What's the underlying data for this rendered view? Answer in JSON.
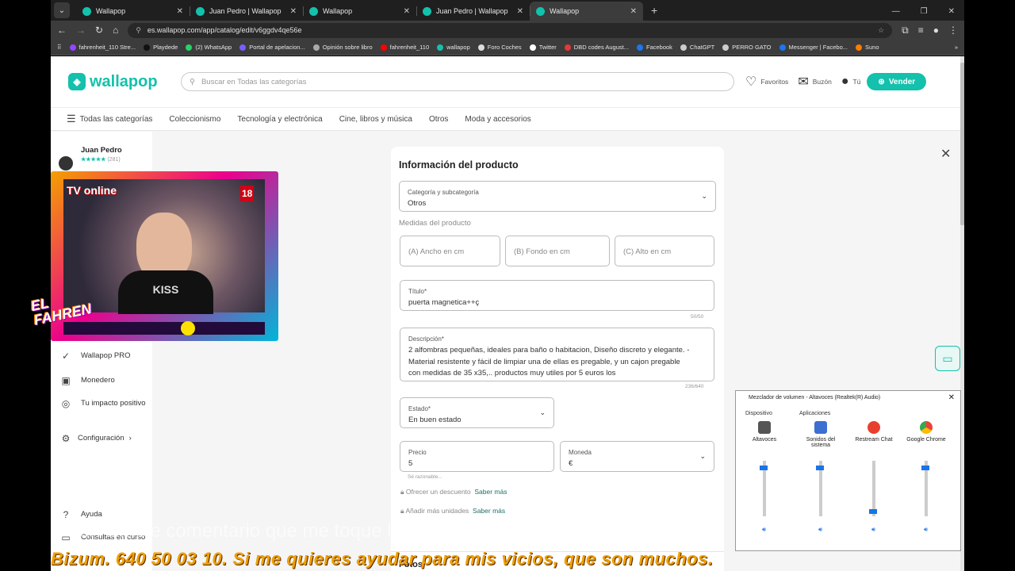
{
  "browser": {
    "tabs": [
      {
        "label": "Wallapop",
        "active": false
      },
      {
        "label": "Juan Pedro | Wallapop",
        "active": false
      },
      {
        "label": "Wallapop",
        "active": false
      },
      {
        "label": "Juan Pedro | Wallapop",
        "active": false
      },
      {
        "label": "Wallapop",
        "active": true
      }
    ],
    "url": "es.wallapop.com/app/catalog/edit/v6ggdv4qe56e",
    "bookmarks": [
      "fahrenheit_110 Stre...",
      "Playdede",
      "(2) WhatsApp",
      "Portal de apelacion...",
      "Opinión sobre libro",
      "fahrenheit_110",
      "wallapop",
      "Foro Coches",
      "Twitter",
      "DBD codes August...",
      "Facebook",
      "ChatGPT",
      "PERRO GATO",
      "Messenger | Facebo...",
      "Suno"
    ]
  },
  "header": {
    "logo": "wallapop",
    "search_placeholder": "Buscar en Todas las categorías",
    "favoritos": "Favoritos",
    "buzon": "Buzón",
    "tu": "Tú",
    "vender": "Vender"
  },
  "catnav": [
    "Todas las categorías",
    "Coleccionismo",
    "Tecnología y electrónica",
    "Cine, libros y música",
    "Otros",
    "Moda y accesorios"
  ],
  "sidebar": {
    "user": "Juan Pedro",
    "stars": "★★★★★",
    "rating_count": "(281)",
    "items": [
      {
        "label": "Wallapop PRO",
        "icon": "✓"
      },
      {
        "label": "Monedero",
        "icon": "▣"
      },
      {
        "label": "Tu impacto positivo",
        "icon": "◎"
      },
      {
        "label": "Configuración",
        "icon": "⚙"
      },
      {
        "label": "Ayuda",
        "icon": "?"
      },
      {
        "label": "Consultas en curso",
        "icon": "▭"
      }
    ]
  },
  "form": {
    "title": "Información del producto",
    "category_label": "Categoría y subcategoría",
    "category_value": "Otros",
    "measures_heading": "Medidas del producto",
    "width_ph": "(A) Ancho en cm",
    "depth_ph": "(B) Fondo en cm",
    "height_ph": "(C) Alto en cm",
    "title_label": "Título*",
    "title_value": "puerta magnetica++ç",
    "title_count": "50/50",
    "desc_label": "Descripción*",
    "desc_value": "2 alfombras pequeñas, ideales para baño o habitacion, Diseño discreto y elegante. - Material resistente y fácil de limpiar una de ellas es pregable, y un cajon pregable con medidas de 35 x35,.. productos muy utiles por 5 euros los",
    "desc_count": "236/640",
    "state_label": "Estado*",
    "state_value": "En buen estado",
    "price_label": "Precio",
    "price_value": "5",
    "currency_label": "Moneda",
    "currency_value": "€",
    "price_hint": "Sé razonable...",
    "discount": "Ofrecer un descuento",
    "units": "Añadir más unidades",
    "saber_mas": "Saber más",
    "fotos": "Fotos"
  },
  "overlay": {
    "tv": "TV online",
    "age": "18",
    "shirt": "KISS",
    "logo_text": "EL FAHREN"
  },
  "mixer": {
    "title": "Mezclador de volumen - Altavoces (Realtek(R) Audio)",
    "device_heading": "Dispositivo",
    "apps_heading": "Aplicaciones",
    "columns": [
      {
        "label": "Altavoces",
        "level": 0.9
      },
      {
        "label": "Sonidos del sistema",
        "level": 0.9
      },
      {
        "label": "Restream Chat",
        "level": 0.05
      },
      {
        "label": "Google Chrome",
        "level": 0.9
      }
    ]
  },
  "subtitle": "un simple comentario que me toque los cojones y te vas bannEado.",
  "banner": "Bizum. 640 50 03 10. Si me quieres ayudar para mis vicios, que son muchos."
}
